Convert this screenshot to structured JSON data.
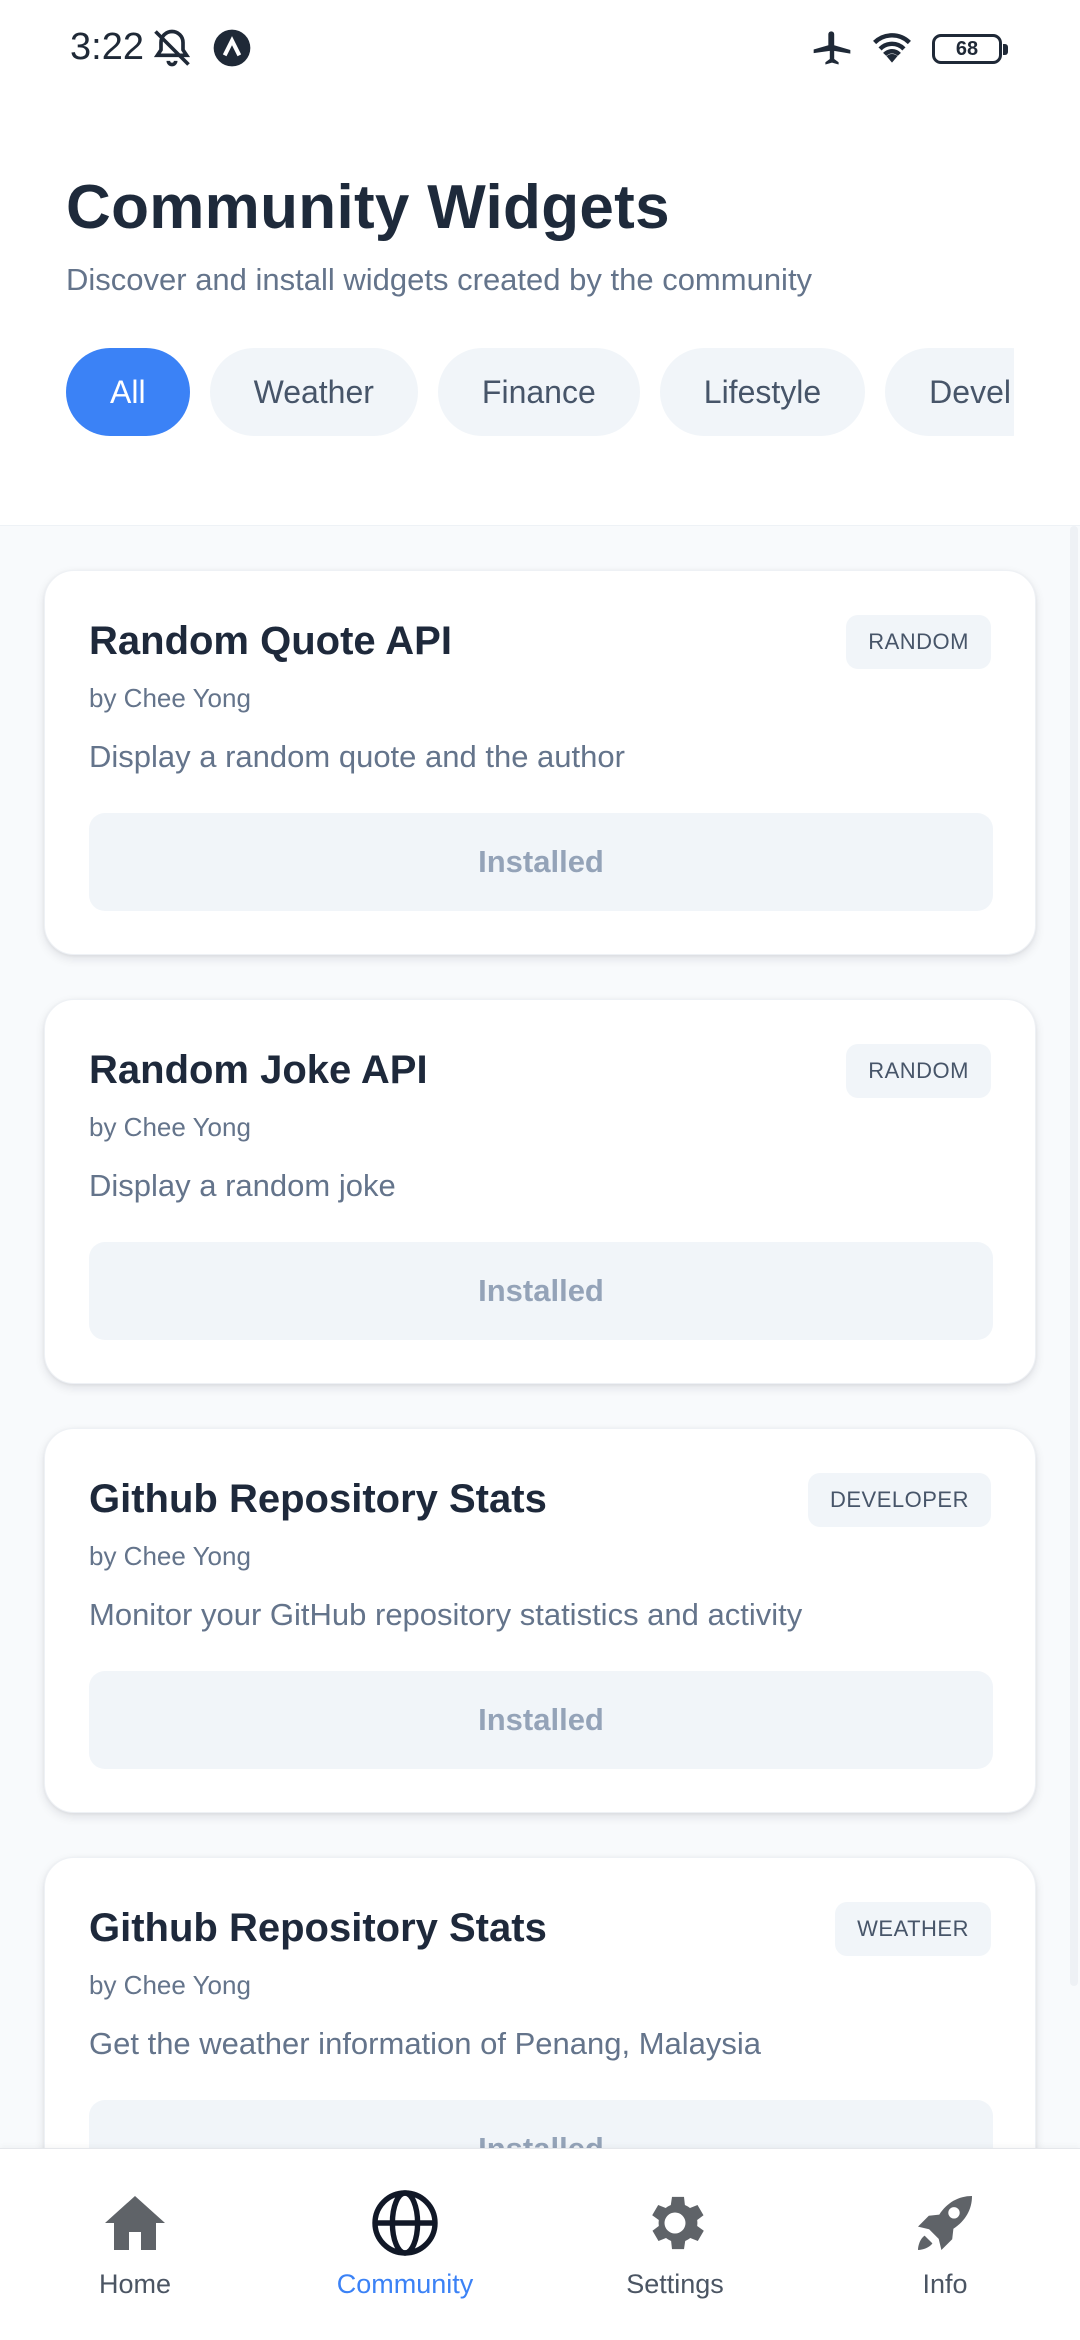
{
  "status_bar": {
    "time": "3:22",
    "battery": "68",
    "icons": [
      "bell-muted-icon",
      "app-notification-icon",
      "airplane-icon",
      "wifi-icon",
      "battery-icon"
    ]
  },
  "header": {
    "title": "Community Widgets",
    "subtitle": "Discover and install widgets created by the community"
  },
  "filters": [
    {
      "label": "All",
      "active": true
    },
    {
      "label": "Weather",
      "active": false
    },
    {
      "label": "Finance",
      "active": false
    },
    {
      "label": "Lifestyle",
      "active": false
    },
    {
      "label": "Devel",
      "active": false
    }
  ],
  "widgets": [
    {
      "title": "Random Quote API",
      "author": "by Chee Yong",
      "description": "Display a random quote and the author",
      "badge": "RANDOM",
      "action": "Installed"
    },
    {
      "title": "Random Joke API",
      "author": "by Chee Yong",
      "description": "Display a random joke",
      "badge": "RANDOM",
      "action": "Installed"
    },
    {
      "title": "Github Repository Stats",
      "author": "by Chee Yong",
      "description": "Monitor your GitHub repository statistics and activity",
      "badge": "DEVELOPER",
      "action": "Installed"
    },
    {
      "title": "Github Repository Stats",
      "author": "by Chee Yong",
      "description": "Get the weather information of Penang, Malaysia",
      "badge": "WEATHER",
      "action": "Installed"
    }
  ],
  "nav": [
    {
      "label": "Home",
      "icon": "home-icon",
      "active": false
    },
    {
      "label": "Community",
      "icon": "globe-icon",
      "active": true
    },
    {
      "label": "Settings",
      "icon": "gear-icon",
      "active": false
    },
    {
      "label": "Info",
      "icon": "rocket-icon",
      "active": false
    }
  ],
  "colors": {
    "accent": "#3b82f6",
    "chip_bg": "#f1f5f9",
    "title": "#1e293b",
    "muted": "#64748b"
  }
}
